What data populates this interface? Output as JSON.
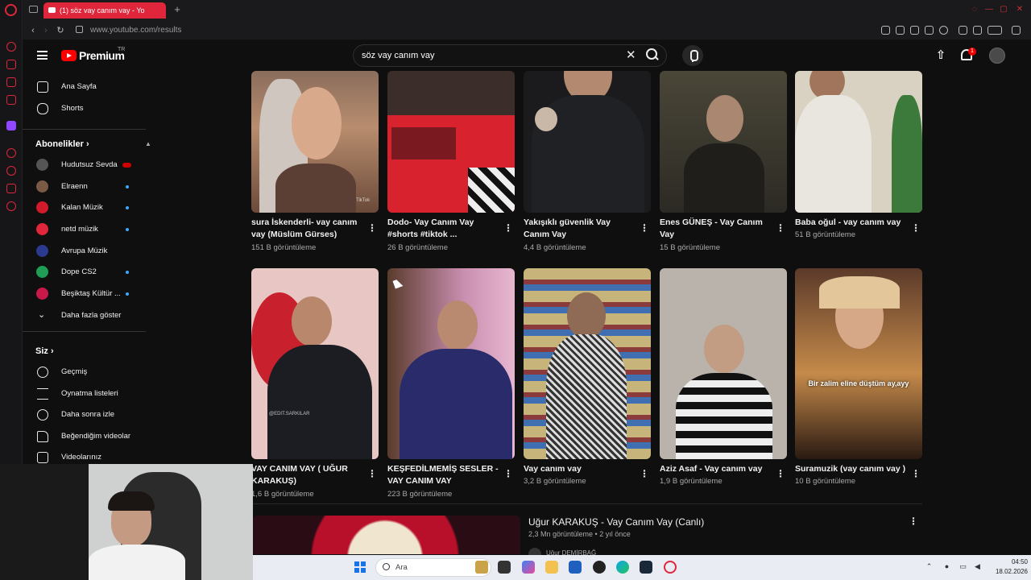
{
  "browser": {
    "tab_title": "(1) söz vay canım vay - Yo",
    "url": "www.youtube.com/results"
  },
  "masthead": {
    "brand": "Premium",
    "region": "TR",
    "search_query": "söz vay canım vay",
    "notifications_count": "1"
  },
  "sidebar": {
    "main": [
      {
        "label": "Ana Sayfa",
        "icon": "home-icon"
      },
      {
        "label": "Shorts",
        "icon": "shorts-icon"
      }
    ],
    "subscriptions_header": "Abonelikler",
    "subscriptions": [
      {
        "label": "Hudutsuz Sevda",
        "status": "live",
        "color": "#555555"
      },
      {
        "label": "Elraenn",
        "status": "new",
        "color": "#7a5a44"
      },
      {
        "label": "Kalan Müzik",
        "status": "new",
        "color": "#d11a2a"
      },
      {
        "label": "netd müzik",
        "status": "new",
        "color": "#e0263b"
      },
      {
        "label": "Avrupa Müzik",
        "status": "none",
        "color": "#2b3a8f"
      },
      {
        "label": "Dope CS2",
        "status": "new",
        "color": "#1f9d55"
      },
      {
        "label": "Beşiktaş Kültür ...",
        "status": "new",
        "color": "#c9184a"
      }
    ],
    "show_more": "Daha fazla göster",
    "you_header": "Siz",
    "you_items": [
      {
        "label": "Geçmiş",
        "icon": "history-icon"
      },
      {
        "label": "Oynatma listeleri",
        "icon": "playlist-icon"
      },
      {
        "label": "Daha sonra izle",
        "icon": "clock-icon"
      },
      {
        "label": "Beğendiğim videolar",
        "icon": "thumbs-up-icon"
      },
      {
        "label": "Videolarınız",
        "icon": "video-icon"
      }
    ]
  },
  "shorts_row1": [
    {
      "title": "sura İskenderli- vay canım vay (Müslüm Gürses)",
      "views": "151 B görüntüleme"
    },
    {
      "title": "Dodo- Vay Canım Vay #shorts #tiktok ...",
      "views": "26 B görüntüleme"
    },
    {
      "title": "Yakışıklı güvenlik Vay Canım Vay",
      "views": "4,4 B görüntüleme"
    },
    {
      "title": "Enes GÜNEŞ - Vay Canım Vay",
      "views": "15 B görüntüleme"
    },
    {
      "title": "Baba oğul - vay canım vay",
      "views": "51 B görüntüleme"
    }
  ],
  "shorts_row2": [
    {
      "title": "VAY CANIM VAY ( UĞUR KARAKUŞ)",
      "views": "1,6 B görüntüleme"
    },
    {
      "title": "KEŞFEDİLMEMİŞ SESLER - VAY CANIM VAY",
      "views": "223 B görüntüleme"
    },
    {
      "title": "Vay canım vay",
      "views": "3,2 B görüntüleme"
    },
    {
      "title": "Aziz Asaf - Vay canım vay",
      "views": "1,9 B görüntüleme"
    },
    {
      "title": "Suramuzik (vay canım vay )",
      "views": "10 B görüntüleme",
      "overlay": "Bir zalim eline düştüm ay,ayy"
    }
  ],
  "long_video": {
    "title": "Uğur KARAKUŞ - Vay Canım Vay (Canlı)",
    "meta": "2,3 Mn görüntüleme • 2 yıl önce",
    "channel": "Uğur DEMİRBAĞ"
  },
  "taskbar": {
    "search_placeholder": "Ara",
    "time": "04:50",
    "date": "18.02.2026"
  },
  "colors": {
    "youtube_red": "#ff0000",
    "opera_red": "#e0263b",
    "background": "#0f0f0f"
  }
}
